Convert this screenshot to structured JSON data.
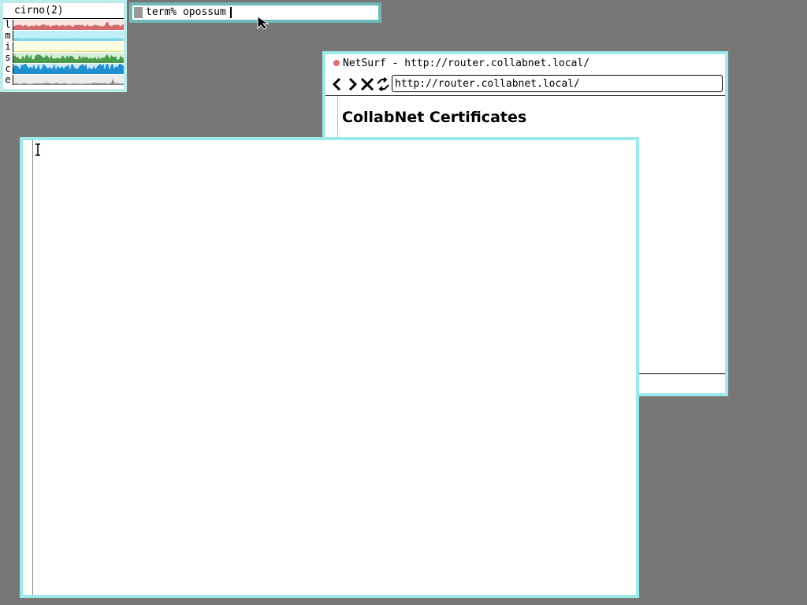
{
  "stats": {
    "title": "cirno(2)",
    "rows": [
      {
        "label": "l",
        "color": "#d26b6b",
        "bg": "#fbe6e6"
      },
      {
        "label": "m",
        "color": "#7fd5e6",
        "bg": "#bff0f7"
      },
      {
        "label": "i",
        "color": "#e2e28a",
        "bg": "#fbfbe0"
      },
      {
        "label": "s",
        "color": "#4c9a4c",
        "bg": "#d6f0d6"
      },
      {
        "label": "c",
        "color": "#1f8fd0",
        "bg": "#cfe9f8"
      },
      {
        "label": "e",
        "color": "#8a8a8a",
        "bg": "#ececec"
      }
    ]
  },
  "prompt": {
    "text": "term% opossum"
  },
  "netsurf": {
    "title": "NetSurf - http://router.collabnet.local/",
    "url": "http://router.collabnet.local/",
    "heading": "CollabNet Certificates",
    "icons": [
      "back-icon",
      "forward-icon",
      "stop-icon",
      "reload-icon"
    ]
  },
  "colors": {
    "desktop": "#777775",
    "border": "#9ee9e9",
    "border_focus": "#6fb8b8"
  }
}
